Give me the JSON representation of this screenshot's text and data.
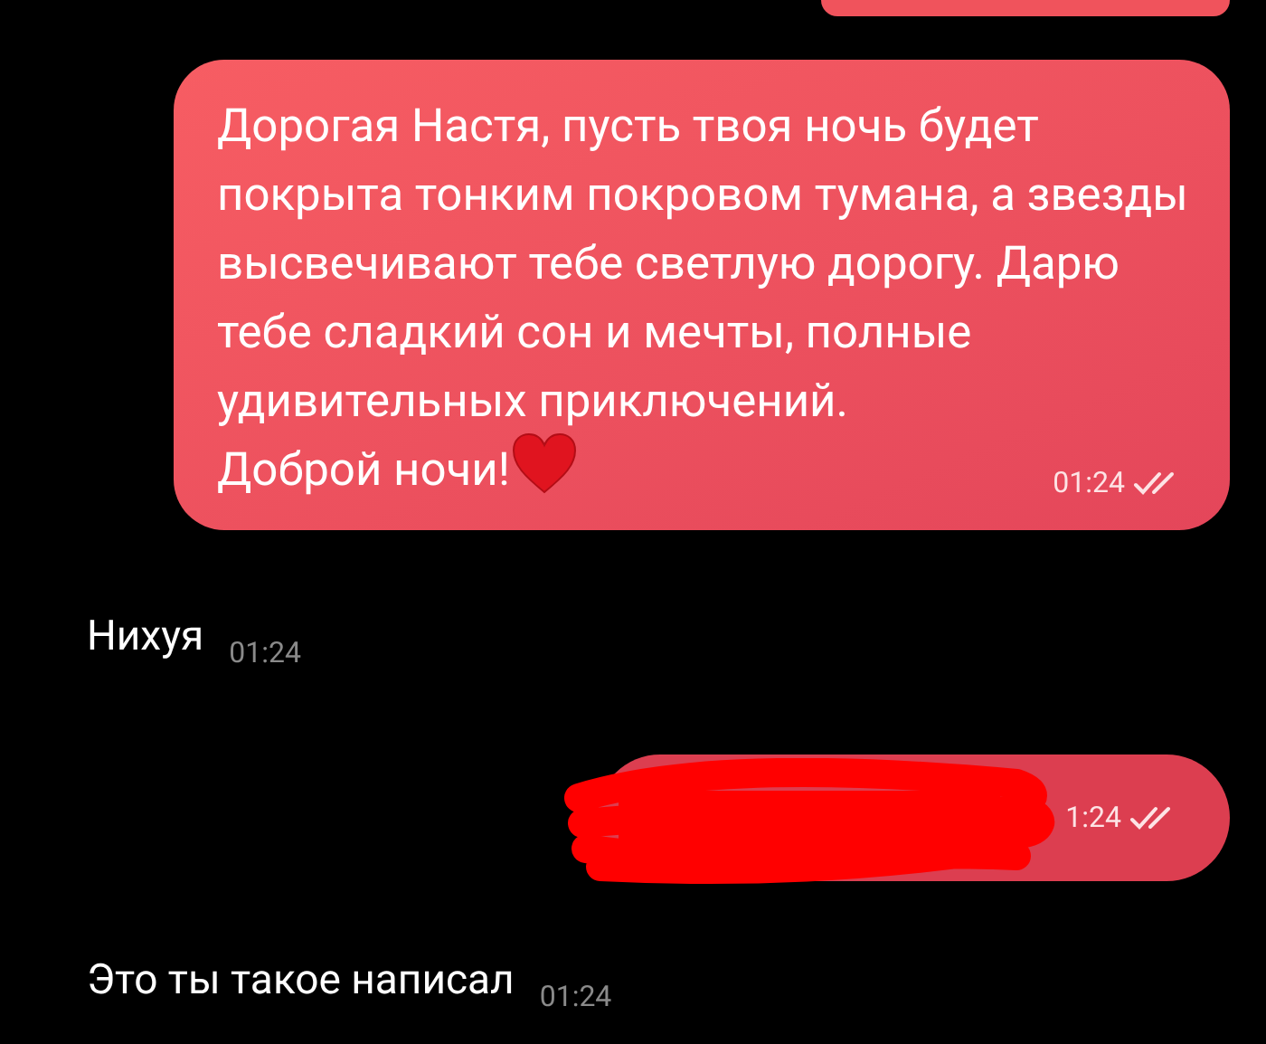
{
  "messages": [
    {
      "kind": "outgoing_cut"
    },
    {
      "kind": "outgoing",
      "text": "Дорогая Настя, пусть твоя ночь будет покрыта тонким покровом тумана, а звезды высвечивают тебе светлую дорогу. Дарю тебе сладкий сон и мечты, полные удивительных приключений.",
      "closing": "Доброй ночи!",
      "heart": true,
      "time": "01:24",
      "read": true
    },
    {
      "kind": "incoming",
      "text": "Нихуя",
      "time": "01:24"
    },
    {
      "kind": "outgoing_redacted",
      "time": "1:24",
      "read": true
    },
    {
      "kind": "incoming",
      "text": "Это ты такое написал",
      "time": "01:24"
    }
  ]
}
